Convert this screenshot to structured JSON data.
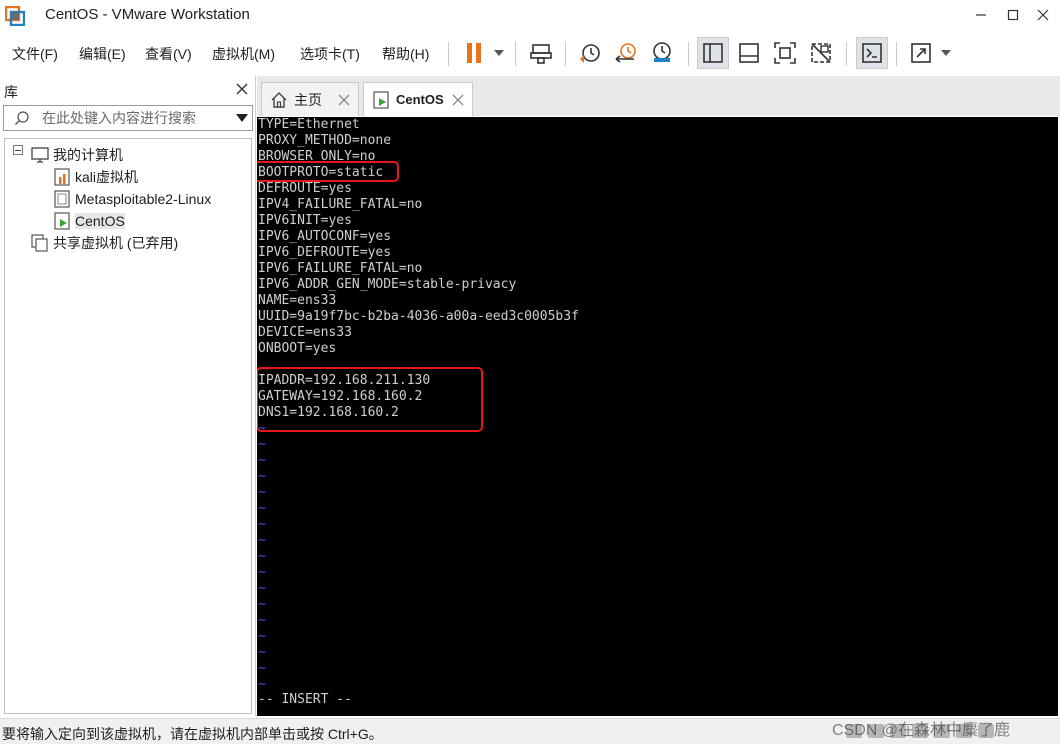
{
  "window": {
    "title": "CentOS - VMware Workstation"
  },
  "menu": {
    "file": "文件(F)",
    "edit": "编辑(E)",
    "view": "查看(V)",
    "vm": "虚拟机(M)",
    "tabs": "选项卡(T)",
    "help": "帮助(H)"
  },
  "toolbar": {
    "icons": [
      "pause-icon",
      "send-keys-icon",
      "snapshot-icon",
      "revert-snapshot-icon",
      "snapshot-manager-icon",
      "library-view-icon",
      "thumbnail-view-icon",
      "fullscreen-icon",
      "unity-icon",
      "console-view-icon",
      "stretch-icon"
    ],
    "accent_color": "#e8731a"
  },
  "library": {
    "title": "库",
    "search_placeholder": "在此处键入内容进行搜索",
    "tree": {
      "root": "我的计算机",
      "vms": [
        {
          "label": "kali虚拟机",
          "icon": "vm-running-icon"
        },
        {
          "label": "Metasploitable2-Linux",
          "icon": "vm-icon"
        },
        {
          "label": "CentOS",
          "icon": "vm-powered-on-icon"
        }
      ],
      "shared": "共享虚拟机 (已弃用)"
    }
  },
  "tabs": [
    {
      "label": "主页",
      "icon": "home-icon"
    },
    {
      "label": "CentOS",
      "icon": "vm-powered-on-icon"
    }
  ],
  "console": {
    "lines": [
      "TYPE=Ethernet",
      "PROXY_METHOD=none",
      "BROWSER_ONLY=no",
      "BOOTPROTO=static",
      "DEFROUTE=yes",
      "IPV4_FAILURE_FATAL=no",
      "IPV6INIT=yes",
      "IPV6_AUTOCONF=yes",
      "IPV6_DEFROUTE=yes",
      "IPV6_FAILURE_FATAL=no",
      "IPV6_ADDR_GEN_MODE=stable-privacy",
      "NAME=ens33",
      "UUID=9a19f7bc-b2ba-4036-a00a-eed3c0005b3f",
      "DEVICE=ens33",
      "ONBOOT=yes",
      "",
      "IPADDR=192.168.211.130",
      "GATEWAY=192.168.160.2",
      "DNS1=192.168.160.2"
    ],
    "tilde": "~",
    "tilde_count": 17,
    "mode_line": "-- INSERT --",
    "text_color": "#cfcfcf",
    "tilde_color": "#3b57d6",
    "highlight_color": "#e8151b"
  },
  "status": {
    "text": "要将输入定向到该虚拟机，请在虚拟机内部单击或按 Ctrl+G。",
    "watermark": "CSDN @在森林中麋了鹿"
  }
}
